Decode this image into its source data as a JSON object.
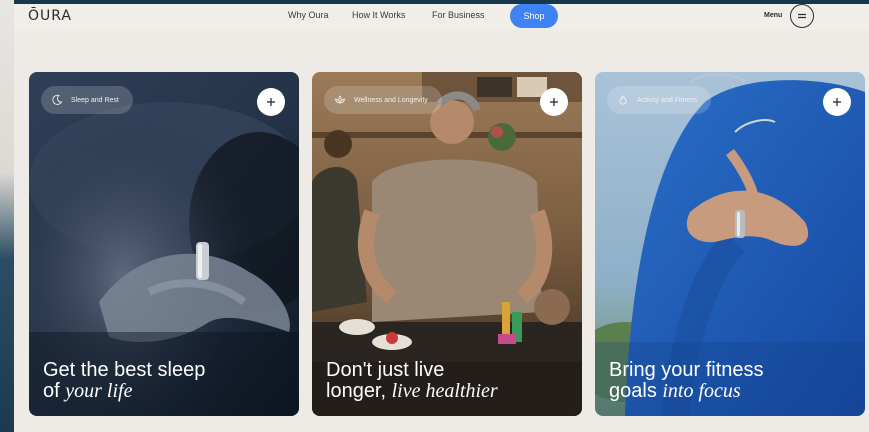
{
  "header": {
    "logo": "ŌURA",
    "nav": [
      "Why Oura",
      "How It Works",
      "For Business"
    ],
    "shop": "Shop",
    "menu": "Menu"
  },
  "cards": [
    {
      "tag": "Sleep and Rest",
      "line1": "Get the best sleep",
      "line2_plain": "of ",
      "line2_italic": "your life"
    },
    {
      "tag": "Wellness and Longevity",
      "line1": "Don't just live",
      "line2_plain": "longer, ",
      "line2_italic": "live healthier"
    },
    {
      "tag": "Activity and Fitness",
      "line1": "Bring your fitness",
      "line2_plain": "goals ",
      "line2_italic": "into focus"
    }
  ],
  "colors": {
    "accent": "#3f82f4",
    "page_bg": "#eeebe6"
  }
}
